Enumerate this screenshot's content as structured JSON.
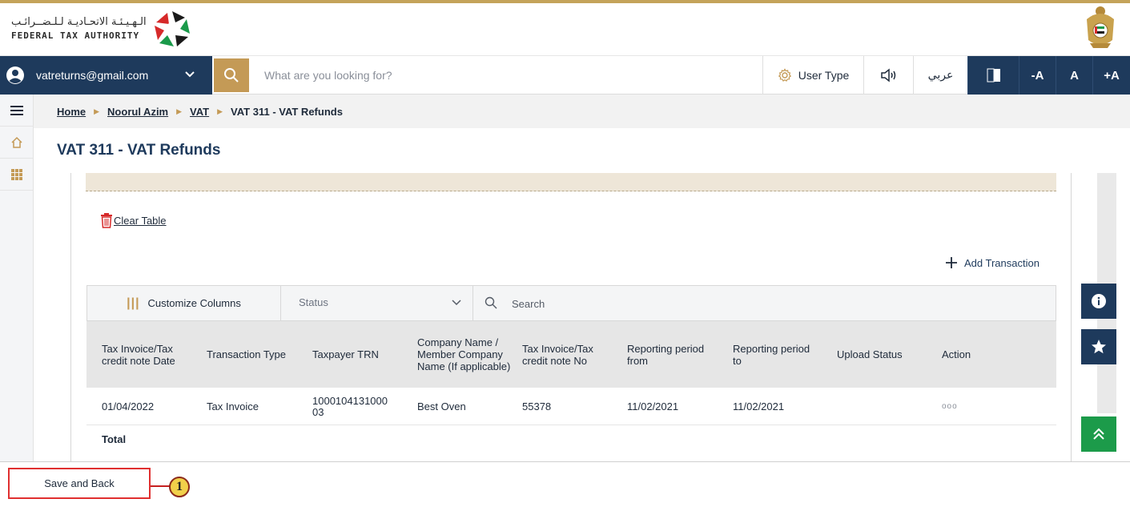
{
  "header": {
    "logo_ar": "الـهـيـئـة الاتحـاديـة لـلـضــرائـب",
    "logo_en": "FEDERAL TAX AUTHORITY"
  },
  "navbar": {
    "email": "vatreturns@gmail.com",
    "search_placeholder": "What are you looking for?",
    "user_type": "User Type",
    "arabic": "عربي",
    "font_minus": "-A",
    "font_normal": "A",
    "font_plus": "+A"
  },
  "breadcrumb": {
    "home": "Home",
    "user": "Noorul Azim",
    "vat": "VAT",
    "current": "VAT 311 - VAT Refunds"
  },
  "page": {
    "title": "VAT 311 - VAT Refunds",
    "clear_table": "Clear Table",
    "add_transaction": "Add Transaction"
  },
  "toolbar": {
    "customize_columns": "Customize Columns",
    "status_label": "Status",
    "search_placeholder": "Search"
  },
  "table": {
    "columns": [
      "Tax Invoice/Tax credit note Date",
      "Transaction Type",
      "Taxpayer TRN",
      "Company Name / Member Company Name (If applicable)",
      "Tax Invoice/Tax credit note No",
      "Reporting period from",
      "Reporting period to",
      "Upload Status",
      "Action"
    ],
    "rows": [
      {
        "date": "01/04/2022",
        "type": "Tax Invoice",
        "trn": "1000104131000 03",
        "company": "Best Oven",
        "invoice_no": "55378",
        "from": "11/02/2021",
        "to": "11/02/2021",
        "upload_status": "",
        "action": "ooo"
      }
    ],
    "total_label": "Total"
  },
  "footer": {
    "save_back": "Save and Back",
    "callout": "1"
  },
  "colors": {
    "navy": "#1e3a5c",
    "gold": "#c49a56",
    "green": "#1c9b4a",
    "highlight_red": "#e03030"
  }
}
